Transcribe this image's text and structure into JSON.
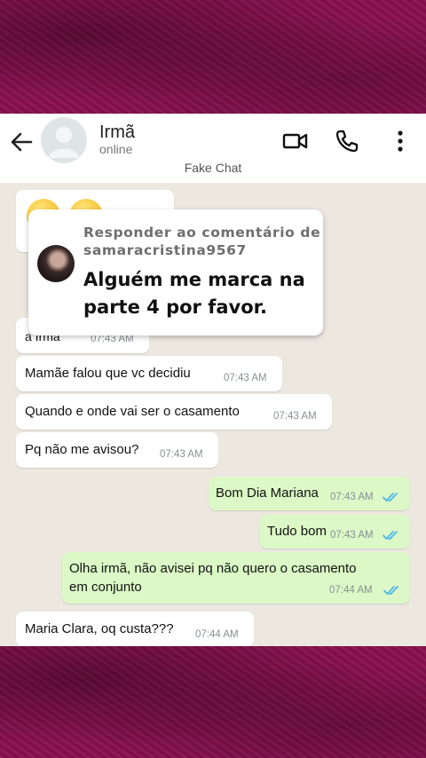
{
  "header": {
    "contact_name": "Irmã",
    "contact_status": "online",
    "subtitle": "Fake Chat"
  },
  "comment_overlay": {
    "header_line1": "Responder ao comentário de",
    "header_line2": "samaracristina9567",
    "text": "Alguém me marca na parte 4 por favor."
  },
  "messages": [
    {
      "dir": "in",
      "text": "a Irmã",
      "time": "07:43 AM"
    },
    {
      "dir": "in",
      "text": "Mamãe falou que vc decidiu",
      "time": "07:43 AM"
    },
    {
      "dir": "in",
      "text": "Quando e onde vai ser o casamento",
      "time": "07:43 AM"
    },
    {
      "dir": "in",
      "text": "Pq não me avisou?",
      "time": "07:43 AM"
    },
    {
      "dir": "out",
      "text": "Bom Dia Mariana",
      "time": "07:43 AM",
      "status": "read"
    },
    {
      "dir": "out",
      "text": "Tudo bom",
      "time": "07:43 AM",
      "status": "read"
    },
    {
      "dir": "out",
      "text": "Olha irmã, não avisei pq não quero o casamento em conjunto",
      "line1": "Olha irmã, não avisei pq não quero o casamento",
      "line2": "em conjunto",
      "time": "07:44 AM",
      "status": "read"
    },
    {
      "dir": "in",
      "text": "Maria Clara, oq custa???",
      "time": "07:44 AM"
    }
  ],
  "colors": {
    "incoming_bubble": "#ffffff",
    "outgoing_bubble": "#dcf8c6",
    "read_ticks": "#4fb6ec",
    "chat_background": "#ece7df",
    "frame": "#8a1150"
  },
  "icons": [
    "back-arrow-icon",
    "video-call-icon",
    "phone-icon",
    "more-vertical-icon",
    "read-ticks-icon"
  ]
}
